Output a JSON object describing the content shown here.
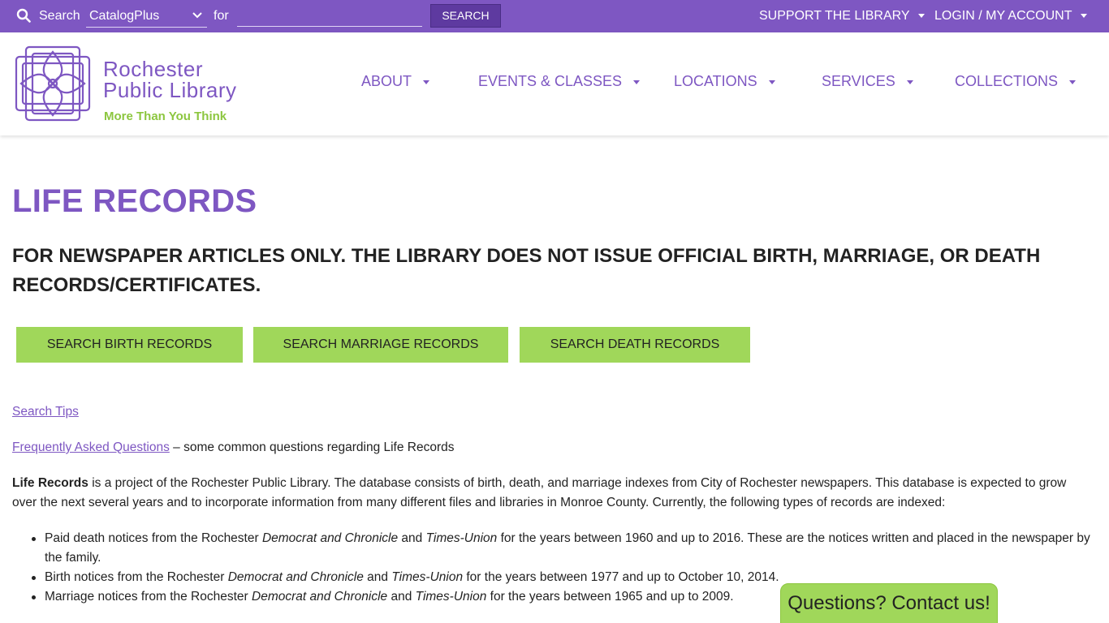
{
  "topbar": {
    "search_label": "Search",
    "scope_selected": "CatalogPlus",
    "for_label": "for",
    "search_value": "",
    "search_placeholder": "",
    "search_button": "SEARCH",
    "support_link": "SUPPORT THE LIBRARY",
    "login_link": "LOGIN / MY ACCOUNT"
  },
  "logo": {
    "name_line1": "Rochester",
    "name_line2": "Public Library",
    "tagline": "More Than You Think"
  },
  "nav": {
    "items": [
      {
        "label": "ABOUT"
      },
      {
        "label": "EVENTS & CLASSES"
      },
      {
        "label": "LOCATIONS"
      },
      {
        "label": "SERVICES"
      },
      {
        "label": "COLLECTIONS"
      }
    ]
  },
  "main": {
    "title": "LIFE RECORDS",
    "subtitle": "FOR NEWSPAPER ARTICLES ONLY. THE LIBRARY DOES NOT ISSUE OFFICIAL BIRTH, MARRIAGE, OR DEATH RECORDS/CERTIFICATES.",
    "buttons": [
      {
        "label": "SEARCH BIRTH RECORDS"
      },
      {
        "label": "SEARCH MARRIAGE RECORDS"
      },
      {
        "label": "SEARCH DEATH RECORDS"
      }
    ],
    "search_tips_link": "Search Tips",
    "faq_link": "Frequently Asked Questions",
    "faq_suffix": " – some common questions regarding Life Records",
    "intro_bold": "Life Records",
    "intro_text": " is a project of the Rochester Public Library. The database consists of birth, death, and marriage indexes from City of Rochester newspapers. This database is expected to grow over the next several years and to incorporate information from many different files and libraries in Monroe County. Currently, the following types of records are indexed:",
    "bullets": [
      {
        "pre": "Paid death notices from the Rochester ",
        "paper1": "Democrat and Chronicle",
        "mid": " and ",
        "paper2": "Times-Union",
        "post": " for the years between 1960 and up to 2016. These are the notices written and placed in the newspaper by the family."
      },
      {
        "pre": "Birth notices from the Rochester ",
        "paper1": "Democrat and Chronicle",
        "mid": " and ",
        "paper2": "Times-Union",
        "post": " for the years between 1977 and up to October 10, 2014."
      },
      {
        "pre": "Marriage notices from the Rochester ",
        "paper1": "Democrat and Chronicle",
        "mid": " and ",
        "paper2": "Times-Union",
        "post": " for the years between 1965 and up to 2009."
      }
    ]
  },
  "contact_tab": "Questions? Contact us!",
  "colors": {
    "brand_purple": "#7e57c2",
    "brand_green": "#a0d75a",
    "tagline_green": "#8cc63f"
  }
}
